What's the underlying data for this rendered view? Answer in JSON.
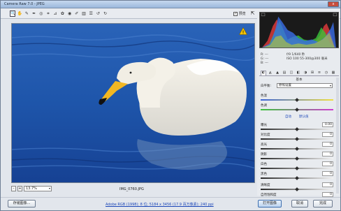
{
  "window": {
    "title": "Camera Raw 7.0 - JPEG",
    "close_label": "x"
  },
  "toolbar": {
    "tools": [
      {
        "name": "zoom-tool",
        "glyph": "🔍"
      },
      {
        "name": "hand-tool",
        "glyph": "✋"
      },
      {
        "name": "white-balance-tool",
        "glyph": "✎"
      },
      {
        "name": "color-sampler-tool",
        "glyph": "✒"
      },
      {
        "name": "targeted-adjustment-tool",
        "glyph": "◎"
      },
      {
        "name": "crop-tool",
        "glyph": "⌗"
      },
      {
        "name": "straighten-tool",
        "glyph": "⊿"
      },
      {
        "name": "spot-removal-tool",
        "glyph": "✿"
      },
      {
        "name": "red-eye-tool",
        "glyph": "◉"
      },
      {
        "name": "adjustment-brush-tool",
        "glyph": "✐"
      },
      {
        "name": "graduated-filter-tool",
        "glyph": "▥"
      },
      {
        "name": "preferences-tool",
        "glyph": "☰"
      },
      {
        "name": "rotate-left-tool",
        "glyph": "↺"
      },
      {
        "name": "rotate-right-tool",
        "glyph": "↻"
      }
    ],
    "preview_label": "预览",
    "preview_checked": "✓",
    "fullscreen_glyph": "⇱"
  },
  "image": {
    "warning_glyph": "!"
  },
  "zoom": {
    "minus": "-",
    "plus": "+",
    "value": "13.7%",
    "arrow": "▾"
  },
  "filename": "IMG_0760.JPG",
  "info": {
    "r": "R: ---",
    "g": "G: ---",
    "b": "B: ---",
    "line1": "f/9  1/640 秒",
    "line2": "ISO 100  55-300@300 毫米"
  },
  "panel": {
    "tab_glyphs": [
      "◐",
      "◭",
      "▲",
      "▤",
      "◫",
      "◧",
      "◑",
      "⊞",
      "≡",
      "◷",
      "▦"
    ],
    "section_title": "基本",
    "wb_label": "白平衡:",
    "wb_value": "原照设置",
    "temp_label": "色温",
    "tint_label": "色调",
    "auto_link": "自动",
    "default_link": "默认值",
    "sliders": [
      {
        "label": "曝光",
        "value": "0.00",
        "pos": 0.5
      },
      {
        "label": "对比度",
        "value": "0",
        "pos": 0.5
      },
      {
        "label": "高光",
        "value": "0",
        "pos": 0.5
      },
      {
        "label": "阴影",
        "value": "0",
        "pos": 0.5
      },
      {
        "label": "白色",
        "value": "0",
        "pos": 0.5
      },
      {
        "label": "黑色",
        "value": "0",
        "pos": 0.5
      },
      {
        "label": "清晰度",
        "value": "0",
        "pos": 0.5
      },
      {
        "label": "自然饱和度",
        "value": "0",
        "pos": 0.5
      }
    ]
  },
  "buttons": {
    "save": "存储图像...",
    "open": "打开图像",
    "cancel": "取消",
    "done": "完成"
  },
  "workflow": "Adobe RGB (1998); 8 位; 5184 x 3456 (17.9 百万像素); 240 ppi",
  "colors": {
    "accent": "#3d6fb0",
    "link": "#1b46b8",
    "sky_water": "#1c4ea0"
  }
}
